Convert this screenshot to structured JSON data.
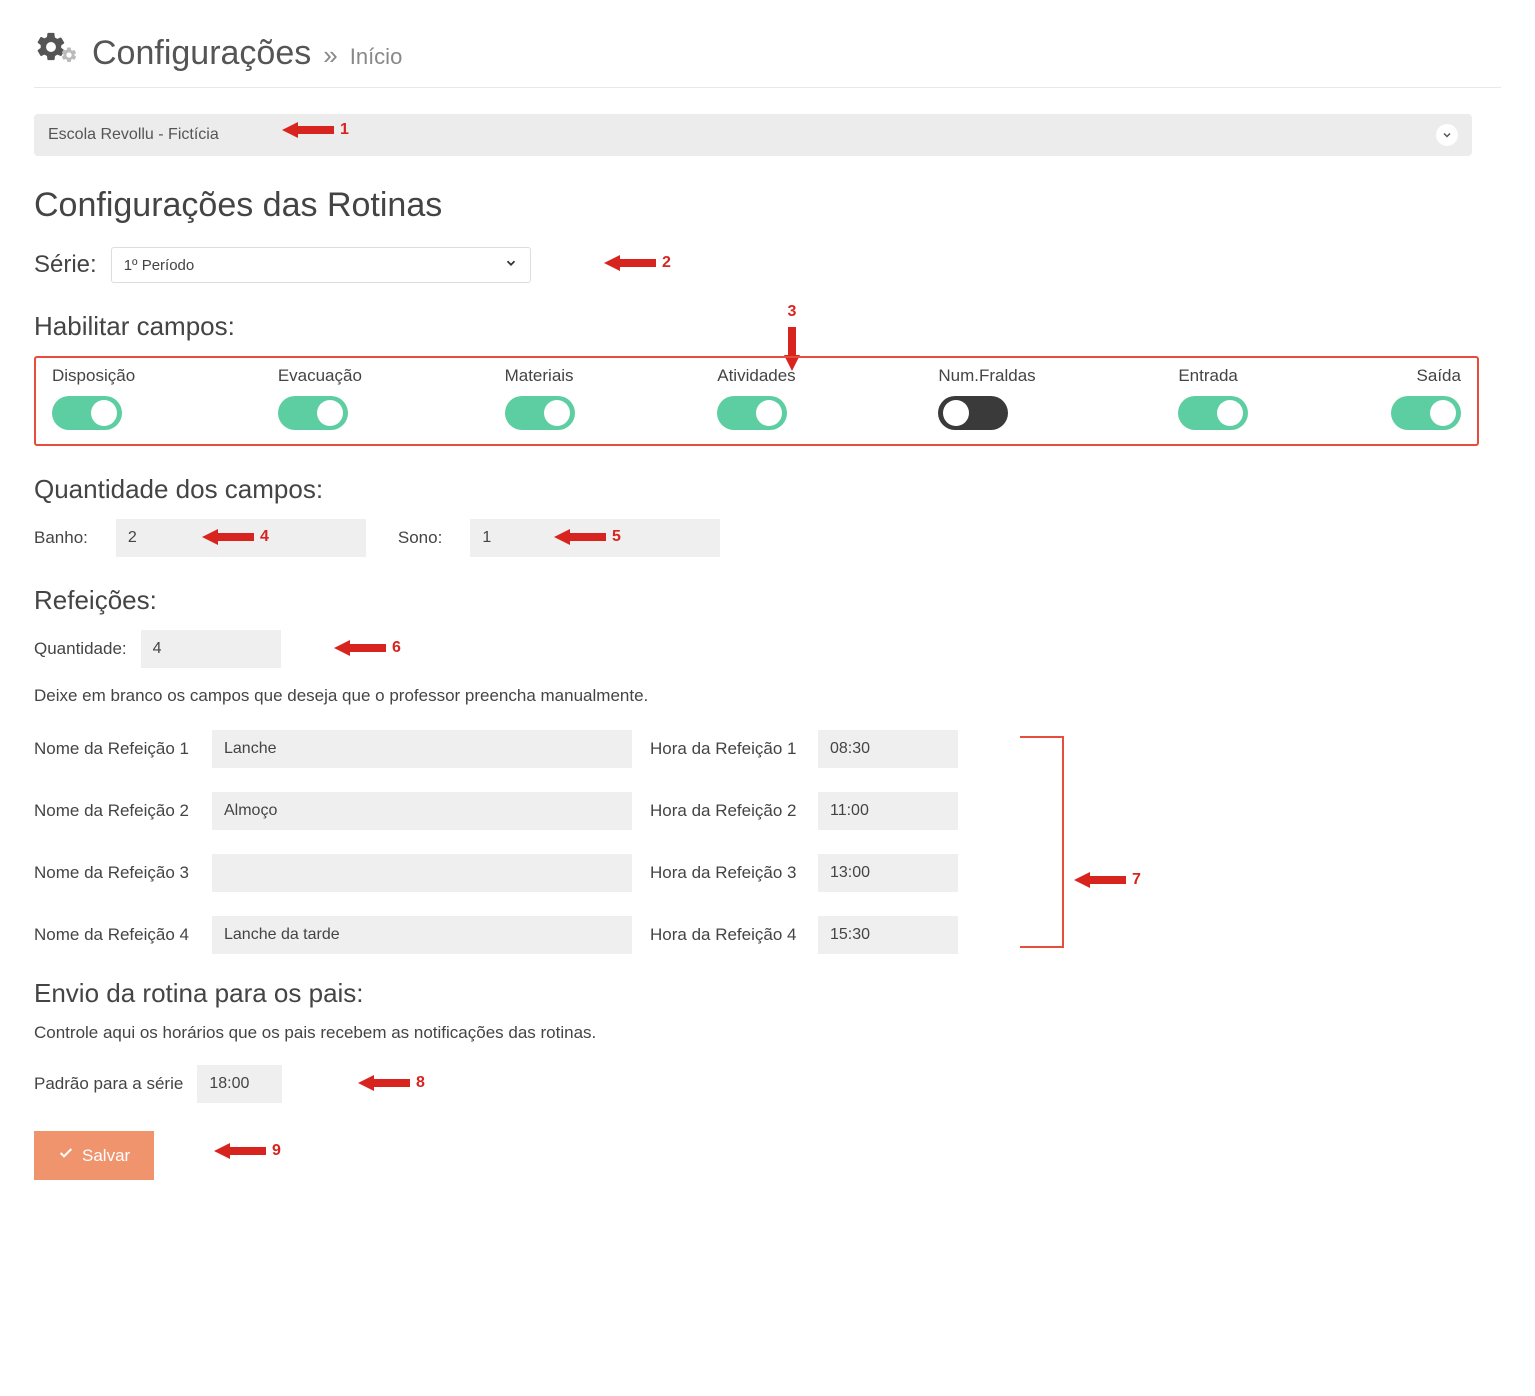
{
  "header": {
    "title": "Configurações",
    "breadcrumb_sep": "»",
    "breadcrumb": "Início"
  },
  "school_select": {
    "selected": "Escola Revollu - Fictícia"
  },
  "section_title": "Configurações das Rotinas",
  "serie": {
    "label": "Série:",
    "value": "1º Período"
  },
  "enable_fields": {
    "label": "Habilitar campos:",
    "items": [
      {
        "label": "Disposição",
        "on": true
      },
      {
        "label": "Evacuação",
        "on": true
      },
      {
        "label": "Materiais",
        "on": true
      },
      {
        "label": "Atividades",
        "on": true
      },
      {
        "label": "Num.Fraldas",
        "on": false
      },
      {
        "label": "Entrada",
        "on": true
      },
      {
        "label": "Saída",
        "on": true
      }
    ]
  },
  "quantities": {
    "label": "Quantidade dos campos:",
    "banho_label": "Banho:",
    "banho_value": "2",
    "sono_label": "Sono:",
    "sono_value": "1"
  },
  "meals": {
    "label": "Refeições:",
    "qty_label": "Quantidade:",
    "qty_value": "4",
    "help": "Deixe em branco os campos que deseja que o professor preencha manualmente.",
    "rows": [
      {
        "name_label": "Nome da Refeição 1",
        "name": "Lanche",
        "time_label": "Hora da Refeição 1",
        "time": "08:30"
      },
      {
        "name_label": "Nome da Refeição 2",
        "name": "Almoço",
        "time_label": "Hora da Refeição 2",
        "time": "11:00"
      },
      {
        "name_label": "Nome da Refeição 3",
        "name": "",
        "time_label": "Hora da Refeição 3",
        "time": "13:00"
      },
      {
        "name_label": "Nome da Refeição 4",
        "name": "Lanche da tarde",
        "time_label": "Hora da Refeição 4",
        "time": "15:30"
      }
    ]
  },
  "send_parents": {
    "label": "Envio da rotina para os pais:",
    "sub": "Controle aqui os horários que os pais recebem as notificações das rotinas.",
    "default_label": "Padrão para a série",
    "default_value": "18:00"
  },
  "save_label": "Salvar",
  "annotations": {
    "a1": "1",
    "a2": "2",
    "a3": "3",
    "a4": "4",
    "a5": "5",
    "a6": "6",
    "a7": "7",
    "a8": "8",
    "a9": "9"
  }
}
